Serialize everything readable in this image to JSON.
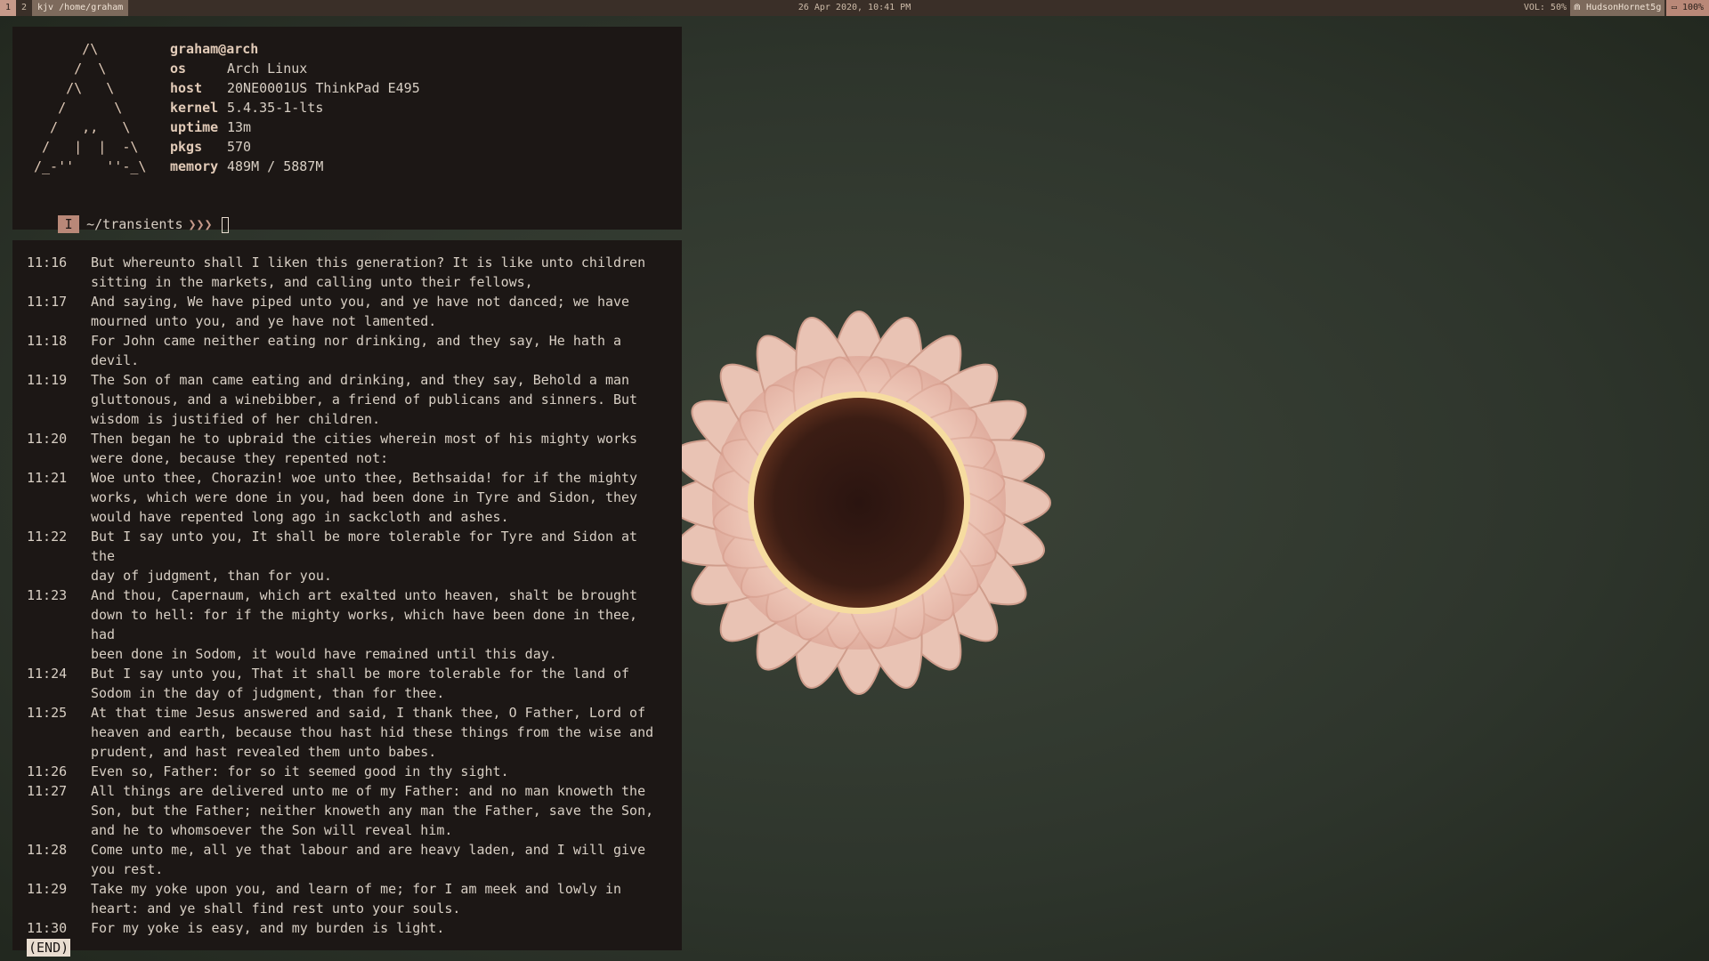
{
  "topbar": {
    "workspaces": [
      "1",
      "2"
    ],
    "window_title": "kjv /home/graham",
    "clock": "26 Apr 2020, 10:41 PM",
    "volume": "VOL: 50%",
    "wifi": "HudsonHornet5g",
    "battery": "100%"
  },
  "fetch": {
    "user_host": "graham@arch",
    "rows": [
      {
        "key": "os",
        "value": "Arch Linux"
      },
      {
        "key": "host",
        "value": "20NE0001US ThinkPad E495"
      },
      {
        "key": "kernel",
        "value": "5.4.35-1-lts"
      },
      {
        "key": "uptime",
        "value": "13m"
      },
      {
        "key": "pkgs",
        "value": "570"
      },
      {
        "key": "memory",
        "value": "489M / 5887M"
      }
    ],
    "ascii_logo": "      /\\\n     /  \\\n    /\\   \\\n   /      \\\n  /   ,,   \\\n /   |  |  -\\\n/_-''    ''-_\\"
  },
  "prompt": {
    "mode": "I",
    "path": "~/transients",
    "arrows": "❯❯❯"
  },
  "pager": {
    "verses": [
      {
        "ref": "11:16",
        "text": "But whereunto shall I liken this generation? It is like unto children\nsitting in the markets, and calling unto their fellows,"
      },
      {
        "ref": "11:17",
        "text": "And saying, We have piped unto you, and ye have not danced; we have\nmourned unto you, and ye have not lamented."
      },
      {
        "ref": "11:18",
        "text": "For John came neither eating nor drinking, and they say, He hath a\ndevil."
      },
      {
        "ref": "11:19",
        "text": "The Son of man came eating and drinking, and they say, Behold a man\ngluttonous, and a winebibber, a friend of publicans and sinners. But\nwisdom is justified of her children."
      },
      {
        "ref": "11:20",
        "text": "Then began he to upbraid the cities wherein most of his mighty works\nwere done, because they repented not:"
      },
      {
        "ref": "11:21",
        "text": "Woe unto thee, Chorazin! woe unto thee, Bethsaida! for if the mighty\nworks, which were done in you, had been done in Tyre and Sidon, they\nwould have repented long ago in sackcloth and ashes."
      },
      {
        "ref": "11:22",
        "text": "But I say unto you, It shall be more tolerable for Tyre and Sidon at the\nday of judgment, than for you."
      },
      {
        "ref": "11:23",
        "text": "And thou, Capernaum, which art exalted unto heaven, shalt be brought\ndown to hell: for if the mighty works, which have been done in thee, had\nbeen done in Sodom, it would have remained until this day."
      },
      {
        "ref": "11:24",
        "text": "But I say unto you, That it shall be more tolerable for the land of\nSodom in the day of judgment, than for thee."
      },
      {
        "ref": "11:25",
        "text": "At that time Jesus answered and said, I thank thee, O Father, Lord of\nheaven and earth, because thou hast hid these things from the wise and\nprudent, and hast revealed them unto babes."
      },
      {
        "ref": "11:26",
        "text": "Even so, Father: for so it seemed good in thy sight."
      },
      {
        "ref": "11:27",
        "text": "All things are delivered unto me of my Father: and no man knoweth the\nSon, but the Father; neither knoweth any man the Father, save the Son,\nand he to whomsoever the Son will reveal him."
      },
      {
        "ref": "11:28",
        "text": "Come unto me, all ye that labour and are heavy laden, and I will give\nyou rest."
      },
      {
        "ref": "11:29",
        "text": "Take my yoke upon you, and learn of me; for I am meek and lowly in\nheart: and ye shall find rest unto your souls."
      },
      {
        "ref": "11:30",
        "text": "For my yoke is easy, and my burden is light."
      }
    ],
    "end_marker": "(END)"
  },
  "colors": {
    "accent": "#b98878",
    "terminal_bg": "#1c1715",
    "bar_bg": "#3a2f28",
    "text": "#d8cfc4"
  },
  "icons": {
    "wifi": "wifi-icon",
    "battery": "battery-icon"
  }
}
